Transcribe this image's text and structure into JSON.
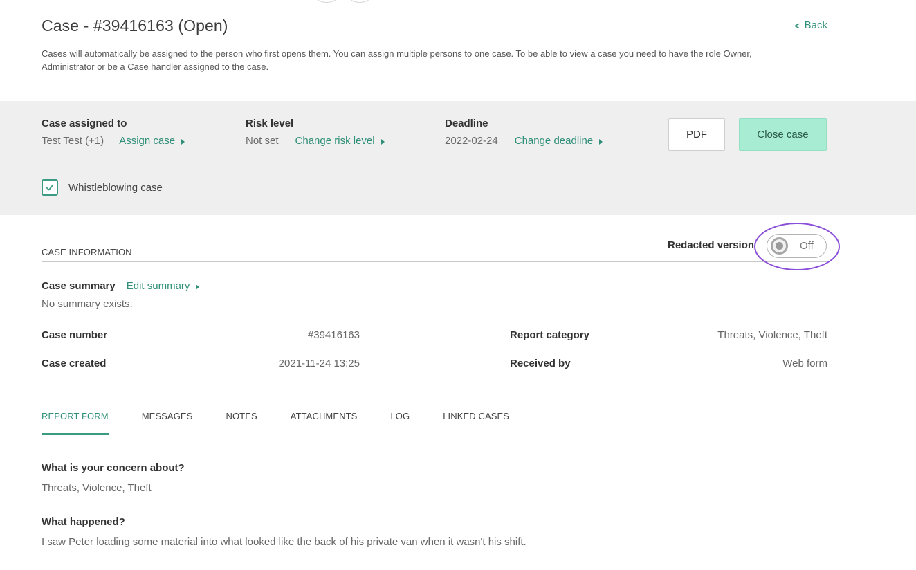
{
  "header": {
    "title": "Case - #39416163 (Open)",
    "back_label": "Back",
    "intro": "Cases will automatically be assigned to the person who first opens them. You can assign multiple persons to one case. To be able to view a case you need to have the role Owner, Administrator or be a Case handler assigned to the case."
  },
  "case_bar": {
    "assigned": {
      "label": "Case assigned to",
      "value": "Test Test (+1)",
      "action": "Assign case"
    },
    "risk": {
      "label": "Risk level",
      "value": "Not set",
      "action": "Change risk level"
    },
    "deadline": {
      "label": "Deadline",
      "value": "2022-02-24",
      "action": "Change deadline"
    },
    "pdf_label": "PDF",
    "close_label": "Close case",
    "whistleblowing": {
      "label": "Whistleblowing case",
      "checked": true
    }
  },
  "case_info": {
    "section_title": "CASE INFORMATION",
    "redacted_label": "Redacted version",
    "redacted_toggle": "Off",
    "summary_label": "Case summary",
    "summary_action": "Edit summary",
    "summary_text": "No summary exists.",
    "case_number_label": "Case number",
    "case_number": "#39416163",
    "case_created_label": "Case created",
    "case_created": "2021-11-24 13:25",
    "report_category_label": "Report category",
    "report_category": "Threats, Violence, Theft",
    "received_by_label": "Received by",
    "received_by": "Web form"
  },
  "tabs": [
    {
      "label": "REPORT FORM",
      "active": true
    },
    {
      "label": "MESSAGES",
      "active": false
    },
    {
      "label": "NOTES",
      "active": false
    },
    {
      "label": "ATTACHMENTS",
      "active": false
    },
    {
      "label": "LOG",
      "active": false
    },
    {
      "label": "LINKED CASES",
      "active": false
    }
  ],
  "report_form": [
    {
      "question": "What is your concern about?",
      "answer": "Threats, Violence, Theft"
    },
    {
      "question": "What happened?",
      "answer": "I saw Peter loading some material into what looked like the back of his private van when it wasn't his shift."
    }
  ],
  "colors": {
    "accent": "#2f8f78",
    "close_button": "#a8ecd4",
    "band": "#efefef",
    "highlight": "#8a4fd8"
  }
}
